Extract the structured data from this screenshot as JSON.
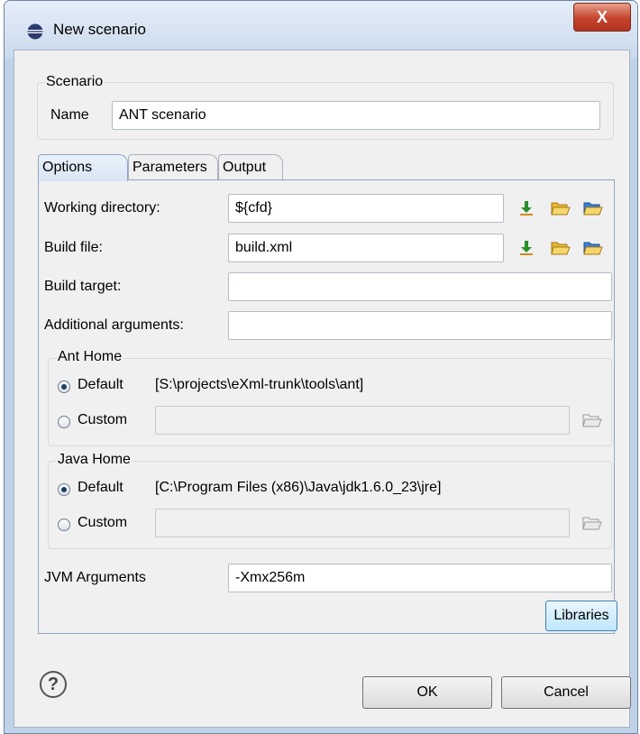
{
  "window": {
    "title": "New scenario",
    "close_glyph": "X"
  },
  "scenario": {
    "group_label": "Scenario",
    "name_label": "Name",
    "name_value": "ANT scenario"
  },
  "tabs": [
    {
      "label": "Options",
      "active": true
    },
    {
      "label": "Parameters",
      "active": false
    },
    {
      "label": "Output",
      "active": false
    }
  ],
  "options": {
    "working_directory": {
      "label": "Working directory:",
      "value": "${cfd}"
    },
    "build_file": {
      "label": "Build file:",
      "value": "build.xml"
    },
    "build_target": {
      "label": "Build target:",
      "value": ""
    },
    "additional_arguments": {
      "label": "Additional arguments:",
      "value": ""
    },
    "ant_home": {
      "group_label": "Ant Home",
      "default_label": "Default",
      "default_path": "[S:\\projects\\eXml-trunk\\tools\\ant]",
      "custom_label": "Custom",
      "custom_value": "",
      "selected": "Default"
    },
    "java_home": {
      "group_label": "Java Home",
      "default_label": "Default",
      "default_path": "[C:\\Program Files (x86)\\Java\\jdk1.6.0_23\\jre]",
      "custom_label": "Custom",
      "custom_value": "",
      "selected": "Default"
    },
    "jvm_arguments": {
      "label": "JVM Arguments",
      "value": "-Xmx256m"
    },
    "libraries_button": "Libraries"
  },
  "footer": {
    "help_glyph": "?",
    "ok_label": "OK",
    "cancel_label": "Cancel"
  },
  "icons": {
    "editor_variables": "insert-variable-icon",
    "browse_local": "open-folder-icon",
    "browse_url": "open-url-folder-icon",
    "help": "help-icon"
  },
  "colors": {
    "window_frame": "#bfd2e8",
    "close_button": "#c4432c",
    "tab_active": "#d9e6f5",
    "variable_icon": "#2a8f2a",
    "folder_icon": "#f3c33d"
  }
}
